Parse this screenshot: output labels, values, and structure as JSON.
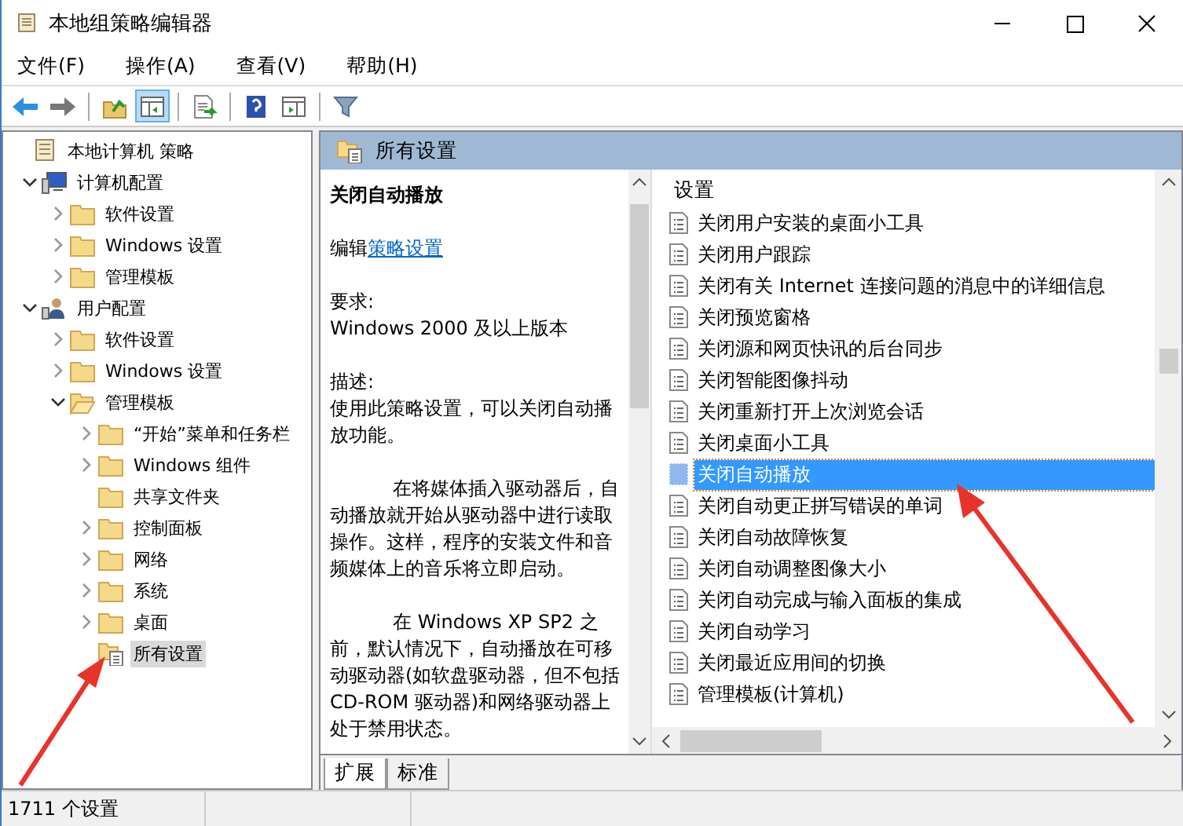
{
  "window": {
    "title": "本地组策略编辑器"
  },
  "menu": [
    "文件(F)",
    "操作(A)",
    "查看(V)",
    "帮助(H)"
  ],
  "toolbar": [
    {
      "kind": "back",
      "pressed": false,
      "separator_after": false
    },
    {
      "kind": "forward",
      "pressed": false,
      "separator_after": true
    },
    {
      "kind": "up",
      "pressed": false,
      "separator_after": false
    },
    {
      "kind": "tree",
      "pressed": true,
      "separator_after": true
    },
    {
      "kind": "export",
      "pressed": false,
      "separator_after": true
    },
    {
      "kind": "help",
      "pressed": false,
      "separator_after": false
    },
    {
      "kind": "pane",
      "pressed": false,
      "separator_after": true
    },
    {
      "kind": "filter",
      "pressed": false,
      "separator_after": false
    }
  ],
  "tree": [
    {
      "label": "本地计算机 策略",
      "kind": "policy",
      "selected": false,
      "children": [
        {
          "label": "计算机配置",
          "kind": "computer",
          "expandable": true,
          "expanded": true,
          "selected": false,
          "children": [
            {
              "label": "软件设置",
              "kind": "folder",
              "expandable": true,
              "expanded": false,
              "selected": false
            },
            {
              "label": "Windows 设置",
              "kind": "folder",
              "expandable": true,
              "expanded": false,
              "selected": false
            },
            {
              "label": "管理模板",
              "kind": "folder",
              "expandable": true,
              "expanded": false,
              "selected": false
            }
          ]
        },
        {
          "label": "用户配置",
          "kind": "user",
          "expandable": true,
          "expanded": true,
          "selected": false,
          "children": [
            {
              "label": "软件设置",
              "kind": "folder",
              "expandable": true,
              "expanded": false,
              "selected": false
            },
            {
              "label": "Windows 设置",
              "kind": "folder",
              "expandable": true,
              "expanded": false,
              "selected": false
            },
            {
              "label": "管理模板",
              "kind": "folder",
              "expandable": true,
              "expanded": true,
              "selected": false,
              "children": [
                {
                  "label": "“开始”菜单和任务栏",
                  "kind": "folder",
                  "expandable": true,
                  "expanded": false,
                  "selected": false
                },
                {
                  "label": "Windows 组件",
                  "kind": "folder",
                  "expandable": true,
                  "expanded": false,
                  "selected": false
                },
                {
                  "label": "共享文件夹",
                  "kind": "folder",
                  "expandable": false,
                  "expanded": false,
                  "selected": false
                },
                {
                  "label": "控制面板",
                  "kind": "folder",
                  "expandable": true,
                  "expanded": false,
                  "selected": false
                },
                {
                  "label": "网络",
                  "kind": "folder",
                  "expandable": true,
                  "expanded": false,
                  "selected": false
                },
                {
                  "label": "系统",
                  "kind": "folder",
                  "expandable": true,
                  "expanded": false,
                  "selected": false
                },
                {
                  "label": "桌面",
                  "kind": "folder",
                  "expandable": true,
                  "expanded": false,
                  "selected": false
                },
                {
                  "label": "所有设置",
                  "kind": "all",
                  "expandable": false,
                  "expanded": false,
                  "selected": true
                }
              ]
            }
          ]
        }
      ]
    }
  ],
  "pane_header": {
    "title": "所有设置"
  },
  "description": {
    "title": "关闭自动播放",
    "edit_prefix": "编辑",
    "edit_link": "策略设置",
    "paragraphs": [
      {
        "kind": "blank",
        "text": "要求:"
      },
      {
        "kind": "plain",
        "text": "Windows 2000 及以上版本"
      },
      {
        "kind": "blank",
        "text": "描述:"
      },
      {
        "kind": "plain",
        "text": "使用此策略设置，可以关闭自动播放功能。"
      },
      {
        "kind": "indent",
        "text": "在将媒体插入驱动器后，自动播放就开始从驱动器中进行读取操作。这样，程序的安装文件和音频媒体上的音乐将立即启动。"
      },
      {
        "kind": "indent",
        "text": "在 Windows XP SP2 之前，默认情况下，自动播放在可移动驱动器(如软盘驱动器，但不包括 CD-ROM 驱动器)和网络驱动器上处于禁用状态。"
      }
    ]
  },
  "settings": {
    "column": "设置",
    "rows": [
      {
        "label": "关闭用户安装的桌面小工具",
        "selected": false
      },
      {
        "label": "关闭用户跟踪",
        "selected": false
      },
      {
        "label": "关闭有关 Internet 连接问题的消息中的详细信息",
        "selected": false
      },
      {
        "label": "关闭预览窗格",
        "selected": false
      },
      {
        "label": "关闭源和网页快讯的后台同步",
        "selected": false
      },
      {
        "label": "关闭智能图像抖动",
        "selected": false
      },
      {
        "label": "关闭重新打开上次浏览会话",
        "selected": false
      },
      {
        "label": "关闭桌面小工具",
        "selected": false
      },
      {
        "label": "关闭自动播放",
        "selected": true
      },
      {
        "label": "关闭自动更正拼写错误的单词",
        "selected": false
      },
      {
        "label": "关闭自动故障恢复",
        "selected": false
      },
      {
        "label": "关闭自动调整图像大小",
        "selected": false
      },
      {
        "label": "关闭自动完成与输入面板的集成",
        "selected": false
      },
      {
        "label": "关闭自动学习",
        "selected": false
      },
      {
        "label": "关闭最近应用间的切换",
        "selected": false
      },
      {
        "label": "管理模板(计算机)",
        "selected": false
      }
    ]
  },
  "tabs": [
    {
      "label": "扩展",
      "selected": true
    },
    {
      "label": "标准",
      "selected": false
    }
  ],
  "status_bar": {
    "text": "1711 个设置"
  }
}
